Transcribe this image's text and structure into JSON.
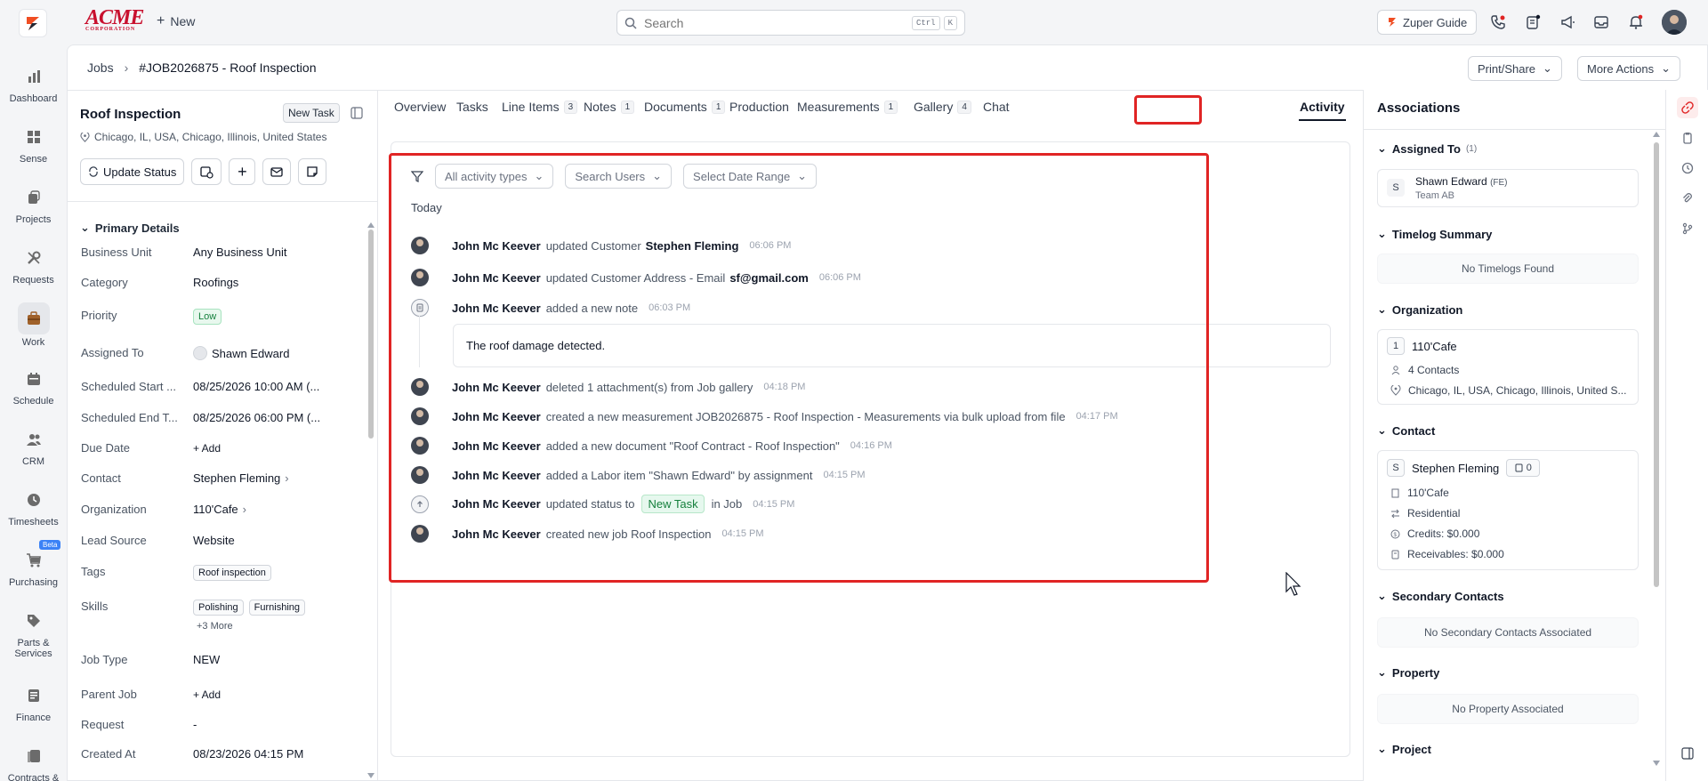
{
  "topbar": {
    "brand": "ACME",
    "brand_sub": "CORPORATION",
    "new_label": "New",
    "search_placeholder": "Search",
    "kbd_ctrl": "Ctrl",
    "kbd_k": "K",
    "guide_label": "Zuper Guide"
  },
  "nav": [
    {
      "label": "Dashboard",
      "icon": "bar-chart-icon"
    },
    {
      "label": "Sense",
      "icon": "grid-icon"
    },
    {
      "label": "Projects",
      "icon": "projects-icon"
    },
    {
      "label": "Requests",
      "icon": "tools-icon"
    },
    {
      "label": "Work",
      "icon": "briefcase-icon"
    },
    {
      "label": "Schedule",
      "icon": "calendar-icon"
    },
    {
      "label": "CRM",
      "icon": "users-icon"
    },
    {
      "label": "Timesheets",
      "icon": "clock-icon"
    },
    {
      "label": "Purchasing",
      "icon": "cart-icon",
      "badge": "Beta"
    },
    {
      "label": "Parts &",
      "label2": "Services",
      "icon": "tag-icon"
    },
    {
      "label": "Finance",
      "icon": "finance-icon"
    },
    {
      "label": "Contracts &",
      "icon": "contracts-icon"
    }
  ],
  "breadcrumb": {
    "root": "Jobs",
    "current": "#JOB2026875 - Roof Inspection"
  },
  "header": {
    "print_share": "Print/Share",
    "more_actions": "More Actions"
  },
  "job": {
    "title": "Roof Inspection",
    "status_chip": "New Task",
    "address": "Chicago, IL, USA, Chicago, Illinois, United States",
    "update_status": "Update Status"
  },
  "details": {
    "section": "Primary Details",
    "fields": [
      {
        "label": "Business Unit",
        "value": "Any Business Unit"
      },
      {
        "label": "Category",
        "value": "Roofings"
      },
      {
        "label": "Priority",
        "value": "Low"
      },
      {
        "label": "Assigned To",
        "value": "Shawn Edward"
      },
      {
        "label": "Scheduled Start ...",
        "value": "08/25/2026 10:00 AM (..."
      },
      {
        "label": "Scheduled End T...",
        "value": "08/25/2026 06:00 PM (..."
      },
      {
        "label": "Due Date",
        "value": "+ Add"
      },
      {
        "label": "Contact",
        "value": "Stephen Fleming"
      },
      {
        "label": "Organization",
        "value": "110'Cafe"
      },
      {
        "label": "Lead Source",
        "value": "Website"
      },
      {
        "label": "Tags",
        "value": "Roof inspection"
      },
      {
        "label": "Skills",
        "value": "Polishing",
        "value2": "Furnishing",
        "more": "+3 More"
      },
      {
        "label": "Job Type",
        "value": "NEW"
      },
      {
        "label": "Parent Job",
        "value": "+ Add"
      },
      {
        "label": "Request",
        "value": "-"
      },
      {
        "label": "Created At",
        "value": "08/23/2026 04:15 PM"
      }
    ]
  },
  "tabs": [
    {
      "label": "Overview"
    },
    {
      "label": "Tasks"
    },
    {
      "label": "Line Items",
      "count": "3"
    },
    {
      "label": "Notes",
      "count": "1"
    },
    {
      "label": "Documents",
      "count": "1"
    },
    {
      "label": "Production"
    },
    {
      "label": "Measurements",
      "count": "1"
    },
    {
      "label": "Gallery",
      "count": "4"
    },
    {
      "label": "Chat"
    },
    {
      "label": "Activity"
    }
  ],
  "activity": {
    "filter_types": "All activity types",
    "filter_users": "Search Users",
    "filter_date": "Select Date Range",
    "group": "Today",
    "items": [
      {
        "user": "John Mc Keever",
        "text": "updated Customer",
        "strong": "Stephen Fleming",
        "time": "06:06 PM"
      },
      {
        "user": "John Mc Keever",
        "text": "updated Customer Address - Email",
        "strong": "sf@gmail.com",
        "time": "06:06 PM"
      },
      {
        "user": "John Mc Keever",
        "text": "added a new note",
        "time": "06:03 PM",
        "note": "The roof damage detected."
      },
      {
        "user": "John Mc Keever",
        "text": "deleted 1 attachment(s) from Job gallery",
        "time": "04:18 PM"
      },
      {
        "user": "John Mc Keever",
        "text": "created a new measurement JOB2026875 - Roof Inspection - Measurements via bulk upload from file",
        "time": "04:17 PM"
      },
      {
        "user": "John Mc Keever",
        "text": "added a new document \"Roof Contract - Roof Inspection\"",
        "time": "04:16 PM"
      },
      {
        "user": "John Mc Keever",
        "text": "added a Labor item \"Shawn Edward\" by assignment",
        "time": "04:15 PM"
      },
      {
        "user": "John Mc Keever",
        "text": "updated status to",
        "badge": "New Task",
        "text2": "in Job",
        "time": "04:15 PM"
      },
      {
        "user": "John Mc Keever",
        "text": "created new job Roof Inspection",
        "time": "04:15 PM"
      }
    ]
  },
  "associations": {
    "title": "Associations",
    "assigned_to": {
      "head": "Assigned To",
      "count": "(1)",
      "initial": "S",
      "name": "Shawn Edward",
      "role": "(FE)",
      "team": "Team AB"
    },
    "timelog": {
      "head": "Timelog Summary",
      "empty": "No Timelogs Found"
    },
    "organization": {
      "head": "Organization",
      "num": "1",
      "name": "110'Cafe",
      "contacts": "4 Contacts",
      "address": "Chicago, IL, USA, Chicago, Illinois, United S..."
    },
    "contact": {
      "head": "Contact",
      "initial": "S",
      "name": "Stephen Fleming",
      "doc_count": "0",
      "org": "110'Cafe",
      "type": "Residential",
      "credits": "Credits: $0.000",
      "receivables": "Receivables: $0.000"
    },
    "secondary": {
      "head": "Secondary Contacts",
      "empty": "No Secondary Contacts Associated"
    },
    "property": {
      "head": "Property",
      "empty": "No Property Associated"
    },
    "project": {
      "head": "Project"
    }
  }
}
